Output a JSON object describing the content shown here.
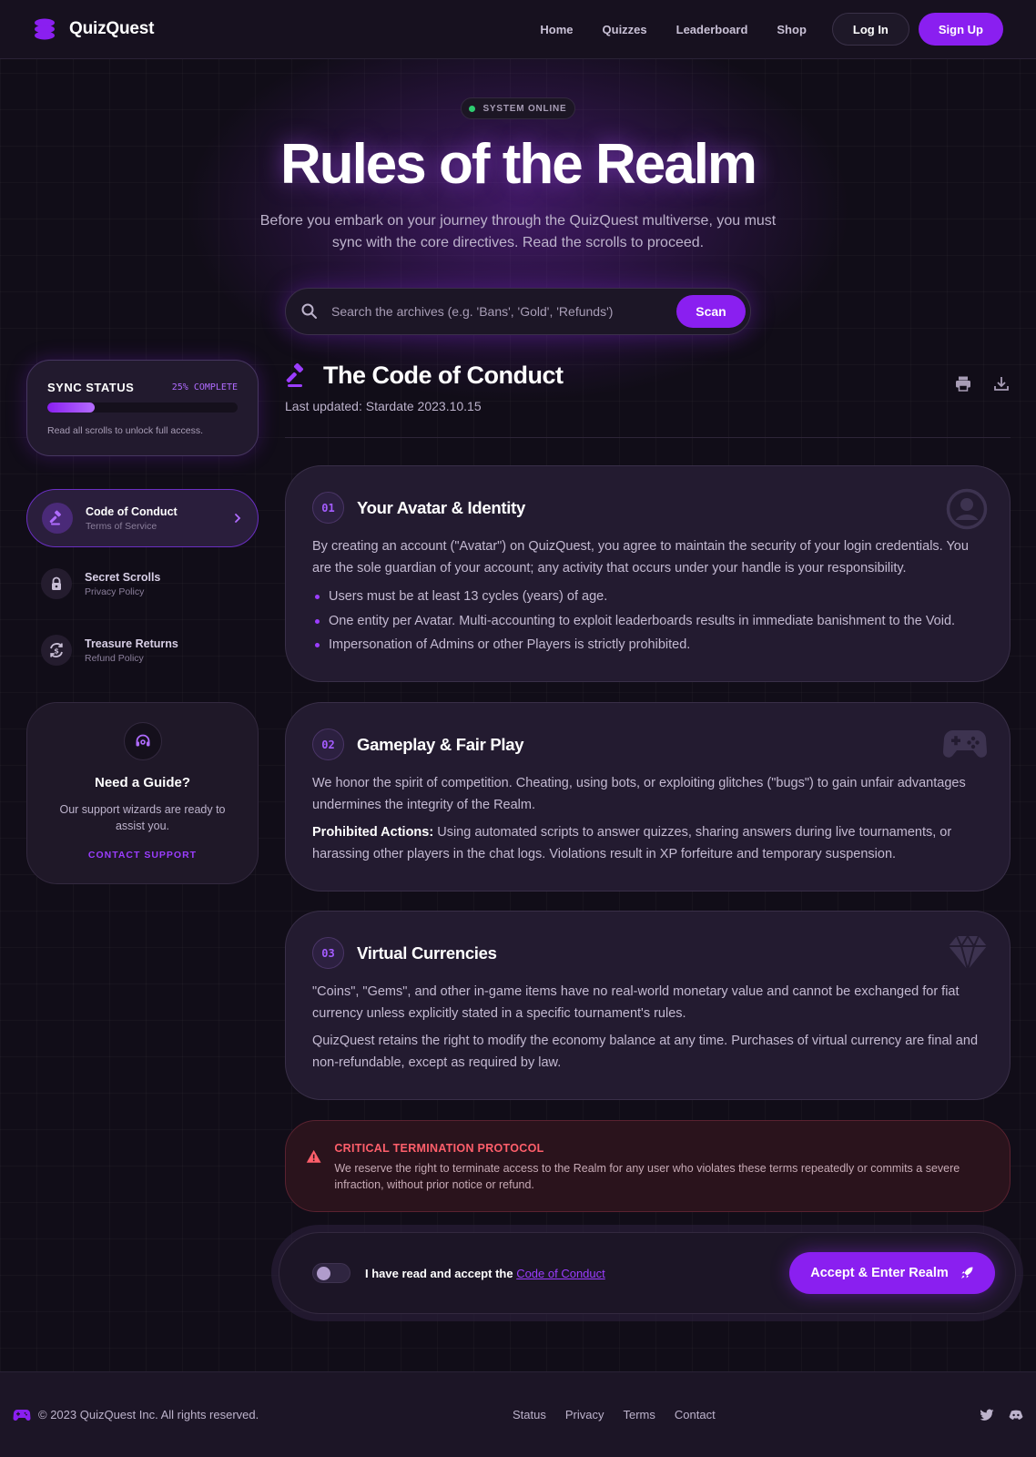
{
  "nav": {
    "brand": "QuizQuest",
    "links": [
      "Home",
      "Quizzes",
      "Leaderboard",
      "Shop"
    ],
    "login": "Log In",
    "signup": "Sign Up"
  },
  "hero": {
    "status": "SYSTEM ONLINE",
    "title": "Rules of the Realm",
    "subtitle": "Before you embark on your journey through the QuizQuest multiverse, you must sync with the core directives. Read the scrolls to proceed."
  },
  "search": {
    "placeholder": "Search the archives (e.g. 'Bans', 'Gold', 'Refunds')",
    "button": "Scan"
  },
  "sync": {
    "title": "SYNC STATUS",
    "percent_label": "25% COMPLETE",
    "progress": 25,
    "note": "Read all scrolls to unlock full access."
  },
  "sidebar": {
    "items": [
      {
        "label": "Code of Conduct",
        "sub": "Terms of Service",
        "icon": "gavel-icon",
        "active": true
      },
      {
        "label": "Secret Scrolls",
        "sub": "Privacy Policy",
        "icon": "lock-icon",
        "active": false
      },
      {
        "label": "Treasure Returns",
        "sub": "Refund Policy",
        "icon": "refund-icon",
        "active": false
      }
    ]
  },
  "guide": {
    "title": "Need a Guide?",
    "text": "Our support wizards are ready to assist you.",
    "link": "CONTACT SUPPORT"
  },
  "doc": {
    "title": "The Code of Conduct",
    "updated": "Last updated: Stardate 2023.10.15"
  },
  "sections": [
    {
      "num": "01",
      "title": "Your Avatar & Identity",
      "icon": "user-circle-icon",
      "p1": "By creating an account (\"Avatar\") on QuizQuest, you agree to maintain the security of your login credentials. You are the sole guardian of your account; any activity that occurs under your handle is your responsibility.",
      "bullets": [
        "Users must be at least 13 cycles (years) of age.",
        "One entity per Avatar. Multi-accounting to exploit leaderboards results in immediate banishment to the Void.",
        "Impersonation of Admins or other Players is strictly prohibited."
      ]
    },
    {
      "num": "02",
      "title": "Gameplay & Fair Play",
      "icon": "gamepad-icon",
      "p1": "We honor the spirit of competition. Cheating, using bots, or exploiting glitches (\"bugs\") to gain unfair advantages undermines the integrity of the Realm.",
      "p2_strong": "Prohibited Actions:",
      "p2": " Using automated scripts to answer quizzes, sharing answers during live tournaments, or harassing other players in the chat logs. Violations result in XP forfeiture and temporary suspension."
    },
    {
      "num": "03",
      "title": "Virtual Currencies",
      "icon": "gem-icon",
      "p1": "\"Coins\", \"Gems\", and other in-game items have no real-world monetary value and cannot be exchanged for fiat currency unless explicitly stated in a specific tournament's rules.",
      "p2": "QuizQuest retains the right to modify the economy balance at any time. Purchases of virtual currency are final and non-refundable, except as required by law."
    }
  ],
  "alert": {
    "title": "CRITICAL TERMINATION PROTOCOL",
    "text": "We reserve the right to terminate access to the Realm for any user who violates these terms repeatedly or commits a severe infraction, without prior notice or refund."
  },
  "accept": {
    "label": "I have read and accept the ",
    "link": "Code of Conduct",
    "button": "Accept & Enter Realm"
  },
  "footer": {
    "copyright": "© 2023 QuizQuest Inc. All rights reserved.",
    "links": [
      "Status",
      "Privacy",
      "Terms",
      "Contact"
    ]
  },
  "colors": {
    "accent": "#8a1ff0",
    "background": "#110d18",
    "danger": "#ff5f6b"
  }
}
